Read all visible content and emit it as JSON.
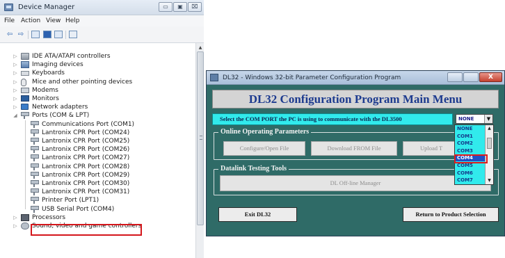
{
  "device_manager": {
    "title": "Device Manager",
    "window_buttons": {
      "minimize": "▭",
      "maximize": "▣",
      "close": "⌧"
    },
    "menu": [
      "File",
      "Action",
      "View",
      "Help"
    ],
    "toolbar_icons": [
      "back-arrow-icon",
      "forward-arrow-icon",
      "properties-icon",
      "help-icon",
      "device-view-icon",
      "scan-hardware-icon"
    ],
    "tree": [
      {
        "label": "IDE ATA/ATAPI controllers",
        "icon": "dev",
        "indent": 0,
        "twisty": "▷"
      },
      {
        "label": "Imaging devices",
        "icon": "img",
        "indent": 0,
        "twisty": "▷"
      },
      {
        "label": "Keyboards",
        "icon": "kbd",
        "indent": 0,
        "twisty": "▷"
      },
      {
        "label": "Mice and other pointing devices",
        "icon": "mouse",
        "indent": 0,
        "twisty": "▷"
      },
      {
        "label": "Modems",
        "icon": "modem",
        "indent": 0,
        "twisty": "▷"
      },
      {
        "label": "Monitors",
        "icon": "monitor",
        "indent": 0,
        "twisty": "▷"
      },
      {
        "label": "Network adapters",
        "icon": "net",
        "indent": 0,
        "twisty": "▷"
      },
      {
        "label": "Ports (COM & LPT)",
        "icon": "port",
        "indent": 0,
        "twisty": "◢"
      },
      {
        "label": "Communications Port (COM1)",
        "icon": "port",
        "indent": 1
      },
      {
        "label": "Lantronix CPR Port (COM24)",
        "icon": "port",
        "indent": 1
      },
      {
        "label": "Lantronix CPR Port (COM25)",
        "icon": "port",
        "indent": 1
      },
      {
        "label": "Lantronix CPR Port (COM26)",
        "icon": "port",
        "indent": 1
      },
      {
        "label": "Lantronix CPR Port (COM27)",
        "icon": "port",
        "indent": 1
      },
      {
        "label": "Lantronix CPR Port (COM28)",
        "icon": "port",
        "indent": 1
      },
      {
        "label": "Lantronix CPR Port (COM29)",
        "icon": "port",
        "indent": 1
      },
      {
        "label": "Lantronix CPR Port (COM30)",
        "icon": "port",
        "indent": 1
      },
      {
        "label": "Lantronix CPR Port (COM31)",
        "icon": "port",
        "indent": 1
      },
      {
        "label": "Printer Port (LPT1)",
        "icon": "port",
        "indent": 1
      },
      {
        "label": "USB Serial Port (COM4)",
        "icon": "port",
        "indent": 1,
        "highlighted": true
      },
      {
        "label": "Processors",
        "icon": "proc",
        "indent": 0,
        "twisty": "▷"
      },
      {
        "label": "Sound, video and game controllers",
        "icon": "sound",
        "indent": 0,
        "twisty": "▷"
      }
    ],
    "highlight_color": "#d4161b"
  },
  "dl32": {
    "title": "DL32 - Windows 32-bit Parameter Configuration Program",
    "close_label": "X",
    "banner": "DL32 Configuration Program Main Menu",
    "com_prompt": "Select the COM PORT the PC is using to communicate with the DL3500",
    "com_selected": "NONE",
    "com_dropdown_arrow": "▼",
    "com_options": [
      "NONE",
      "COM1",
      "COM2",
      "COM3",
      "COM4",
      "COM5",
      "COM6",
      "COM7"
    ],
    "com_highlighted": "COM4",
    "groups": {
      "online": {
        "title": "Online Operating Parameters",
        "buttons": [
          "Configure/Open File",
          "Download FROM File",
          "Upload T"
        ]
      },
      "tools": {
        "title": "Datalink Testing Tools",
        "buttons": [
          "DL Off-line Manager"
        ]
      }
    },
    "exit_label": "Exit DL32",
    "return_label": "Return to Product Selection",
    "colors": {
      "window_bg": "#2f6b67",
      "prompt_bg": "#31eaec",
      "banner_text": "#1d3b8f",
      "dropdown_selected": "#1f4fc7",
      "highlight": "#e01a1a"
    }
  }
}
